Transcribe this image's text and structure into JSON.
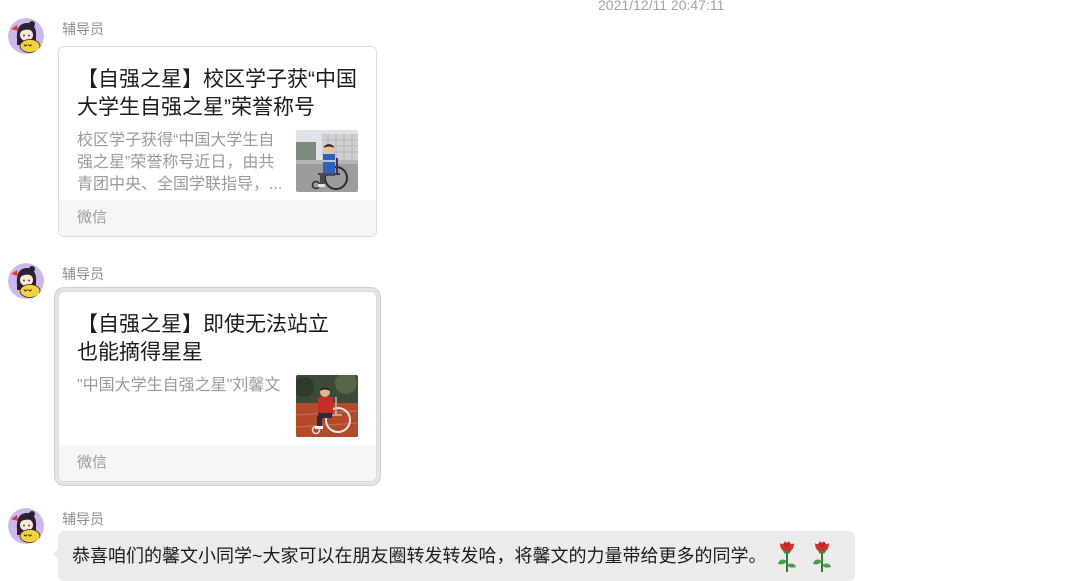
{
  "timestamp": "2021/12/11 20:47:11",
  "messages": [
    {
      "sender": "辅导员",
      "title": "【自强之星】校区学子获“中国大学生自强之星”荣誉称号",
      "description": "校区学子获得“中国大学生自强之星”荣誉称号近日，由共青团中央、全国学联指导，...",
      "source": "微信",
      "selected": false
    },
    {
      "sender": "辅导员",
      "title": "【自强之星】即使无法站立\n也能摘得星星",
      "description": "\"中国大学生自强之星\"刘馨文",
      "source": "微信",
      "selected": true
    },
    {
      "sender": "辅导员",
      "text": "恭喜咱们的馨文小同学~大家可以在朋友圈转发转发哈，将馨文的力量带给更多的同学。",
      "emoji": [
        "rose",
        "rose"
      ]
    }
  ],
  "colors": {
    "bubble_bg": "#ebebeb",
    "card_border": "#dcdcdc",
    "card_footer_bg": "#f6f6f8",
    "selected_ring": "#cfcfcf",
    "muted_text": "#9a9a9a"
  }
}
